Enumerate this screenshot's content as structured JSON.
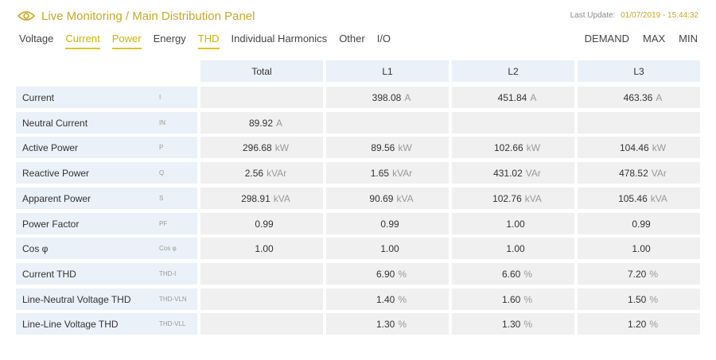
{
  "header": {
    "title": "Live Monitoring / Main Distribution Panel",
    "last_update_label": "Last Update:",
    "last_update_value": "01/07/2019 - 15:44:32",
    "icon": "eye-icon",
    "accent_color": "#c8a826"
  },
  "tabs": [
    {
      "label": "Voltage",
      "active": false
    },
    {
      "label": "Current",
      "active": true
    },
    {
      "label": "Power",
      "active": true
    },
    {
      "label": "Energy",
      "active": false
    },
    {
      "label": "THD",
      "active": true
    },
    {
      "label": "Individual Harmonics",
      "active": false
    },
    {
      "label": "Other",
      "active": false
    },
    {
      "label": "I/O",
      "active": false
    }
  ],
  "modes": [
    "DEMAND",
    "MAX",
    "MIN"
  ],
  "table": {
    "columns": [
      "Total",
      "L1",
      "L2",
      "L3"
    ],
    "rows": [
      {
        "name": "Current",
        "symbol": "I",
        "total": "",
        "total_unit": "",
        "l1": "398.08",
        "l1_unit": "A",
        "l2": "451.84",
        "l2_unit": "A",
        "l3": "463.36",
        "l3_unit": "A"
      },
      {
        "name": "Neutral Current",
        "symbol": "IN",
        "total": "89.92",
        "total_unit": "A",
        "l1": "",
        "l1_unit": "",
        "l2": "",
        "l2_unit": "",
        "l3": "",
        "l3_unit": ""
      },
      {
        "name": "Active Power",
        "symbol": "P",
        "total": "296.68",
        "total_unit": "kW",
        "l1": "89.56",
        "l1_unit": "kW",
        "l2": "102.66",
        "l2_unit": "kW",
        "l3": "104.46",
        "l3_unit": "kW"
      },
      {
        "name": "Reactive Power",
        "symbol": "Q",
        "total": "2.56",
        "total_unit": "kVAr",
        "l1": "1.65",
        "l1_unit": "kVAr",
        "l2": "431.02",
        "l2_unit": "VAr",
        "l3": "478.52",
        "l3_unit": "VAr"
      },
      {
        "name": "Apparent Power",
        "symbol": "S",
        "total": "298.91",
        "total_unit": "kVA",
        "l1": "90.69",
        "l1_unit": "kVA",
        "l2": "102.76",
        "l2_unit": "kVA",
        "l3": "105.46",
        "l3_unit": "kVA"
      },
      {
        "name": "Power Factor",
        "symbol": "PF",
        "total": "0.99",
        "total_unit": "",
        "l1": "0.99",
        "l1_unit": "",
        "l2": "1.00",
        "l2_unit": "",
        "l3": "0.99",
        "l3_unit": ""
      },
      {
        "name": "Cos φ",
        "symbol": "Cos φ",
        "total": "1.00",
        "total_unit": "",
        "l1": "1.00",
        "l1_unit": "",
        "l2": "1.00",
        "l2_unit": "",
        "l3": "1.00",
        "l3_unit": ""
      },
      {
        "name": "Current THD",
        "symbol": "THD-I",
        "total": "",
        "total_unit": "",
        "l1": "6.90",
        "l1_unit": "%",
        "l2": "6.60",
        "l2_unit": "%",
        "l3": "7.20",
        "l3_unit": "%"
      },
      {
        "name": "Line-Neutral Voltage THD",
        "symbol": "THD-VLN",
        "total": "",
        "total_unit": "",
        "l1": "1.40",
        "l1_unit": "%",
        "l2": "1.60",
        "l2_unit": "%",
        "l3": "1.50",
        "l3_unit": "%"
      },
      {
        "name": "Line-Line Voltage THD",
        "symbol": "THD-VLL",
        "total": "",
        "total_unit": "",
        "l1": "1.30",
        "l1_unit": "%",
        "l2": "1.30",
        "l2_unit": "%",
        "l3": "1.20",
        "l3_unit": "%"
      }
    ]
  }
}
